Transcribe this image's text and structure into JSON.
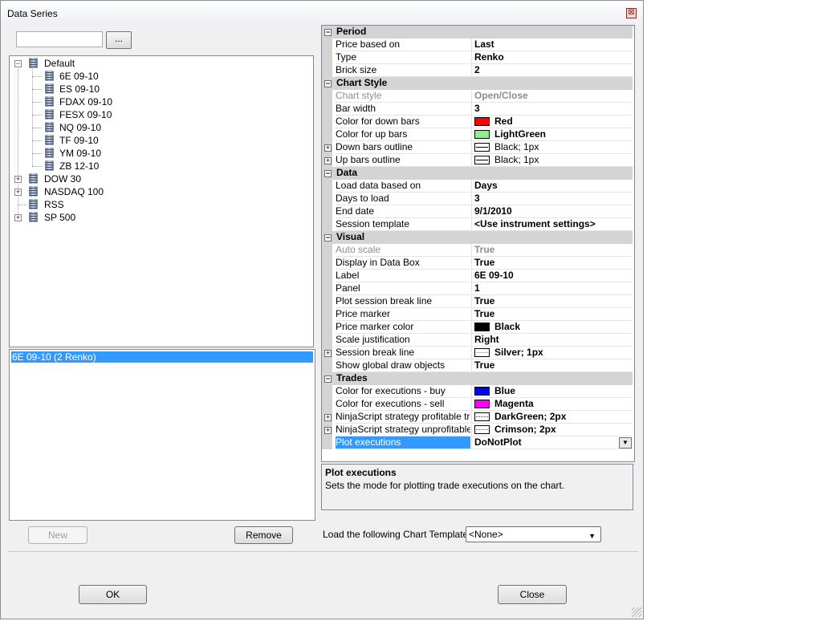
{
  "window": {
    "title": "Data Series",
    "close_glyph": "⊠"
  },
  "instrument_search": {
    "value": "",
    "browse_label": "..."
  },
  "tree": {
    "default_folder": "Default",
    "default_items": [
      "6E 09-10",
      "ES 09-10",
      "FDAX 09-10",
      "FESX 09-10",
      "NQ 09-10",
      "TF 09-10",
      "YM 09-10",
      "ZB 12-10"
    ],
    "folders": [
      "DOW 30",
      "NASDAQ 100",
      "RSS",
      "SP 500"
    ]
  },
  "series_list": {
    "selected": "6E 09-10 (2 Renko)"
  },
  "buttons": {
    "new": "New",
    "remove": "Remove",
    "ok": "OK",
    "close": "Close"
  },
  "properties": {
    "period": {
      "title": "Period",
      "rows": [
        {
          "name": "Price based on",
          "value": "Last"
        },
        {
          "name": "Type",
          "value": "Renko"
        },
        {
          "name": "Brick size",
          "value": "2"
        }
      ]
    },
    "chart_style": {
      "title": "Chart Style",
      "chart_style": {
        "name": "Chart style",
        "value": "Open/Close"
      },
      "bar_width": {
        "name": "Bar width",
        "value": "3"
      },
      "color_down": {
        "name": "Color for down bars",
        "value": "Red",
        "color": "#ff0000"
      },
      "color_up": {
        "name": "Color for up bars",
        "value": "LightGreen",
        "color": "#90ee90"
      },
      "down_outline": {
        "name": "Down bars outline",
        "value": "Black; 1px"
      },
      "up_outline": {
        "name": "Up bars outline",
        "value": "Black; 1px"
      }
    },
    "data": {
      "title": "Data",
      "rows": [
        {
          "name": "Load data based on",
          "value": "Days"
        },
        {
          "name": "Days to load",
          "value": "3"
        },
        {
          "name": "End date",
          "value": "9/1/2010"
        },
        {
          "name": "Session template",
          "value": "<Use instrument settings>"
        }
      ]
    },
    "visual": {
      "title": "Visual",
      "auto_scale": {
        "name": "Auto scale",
        "value": "True"
      },
      "display_data_box": {
        "name": "Display in Data Box",
        "value": "True"
      },
      "label": {
        "name": "Label",
        "value": "6E 09-10"
      },
      "panel": {
        "name": "Panel",
        "value": "1"
      },
      "plot_session_break": {
        "name": "Plot session break line",
        "value": "True"
      },
      "price_marker": {
        "name": "Price marker",
        "value": "True"
      },
      "price_marker_color": {
        "name": "Price marker color",
        "value": "Black",
        "color": "#000000"
      },
      "scale_justification": {
        "name": "Scale justification",
        "value": "Right"
      },
      "session_break_line": {
        "name": "Session break line",
        "value": "Silver; 1px"
      },
      "show_global_draw": {
        "name": "Show global draw objects",
        "value": "True"
      }
    },
    "trades": {
      "title": "Trades",
      "exec_buy": {
        "name": "Color for executions - buy",
        "value": "Blue",
        "color": "#0000ff"
      },
      "exec_sell": {
        "name": "Color for executions - sell",
        "value": "Magenta",
        "color": "#ff00ff"
      },
      "profitable": {
        "name": "NinjaScript strategy profitable trades",
        "value": "DarkGreen; 2px"
      },
      "unprofitable": {
        "name": "NinjaScript strategy unprofitable trades",
        "value": "Crimson; 2px"
      },
      "plot_exec": {
        "name": "Plot executions",
        "value": "DoNotPlot"
      }
    }
  },
  "description": {
    "title": "Plot executions",
    "text": "Sets the mode for plotting trade executions on the chart."
  },
  "chart_template": {
    "label": "Load the following Chart Template:",
    "value": "<None>"
  }
}
